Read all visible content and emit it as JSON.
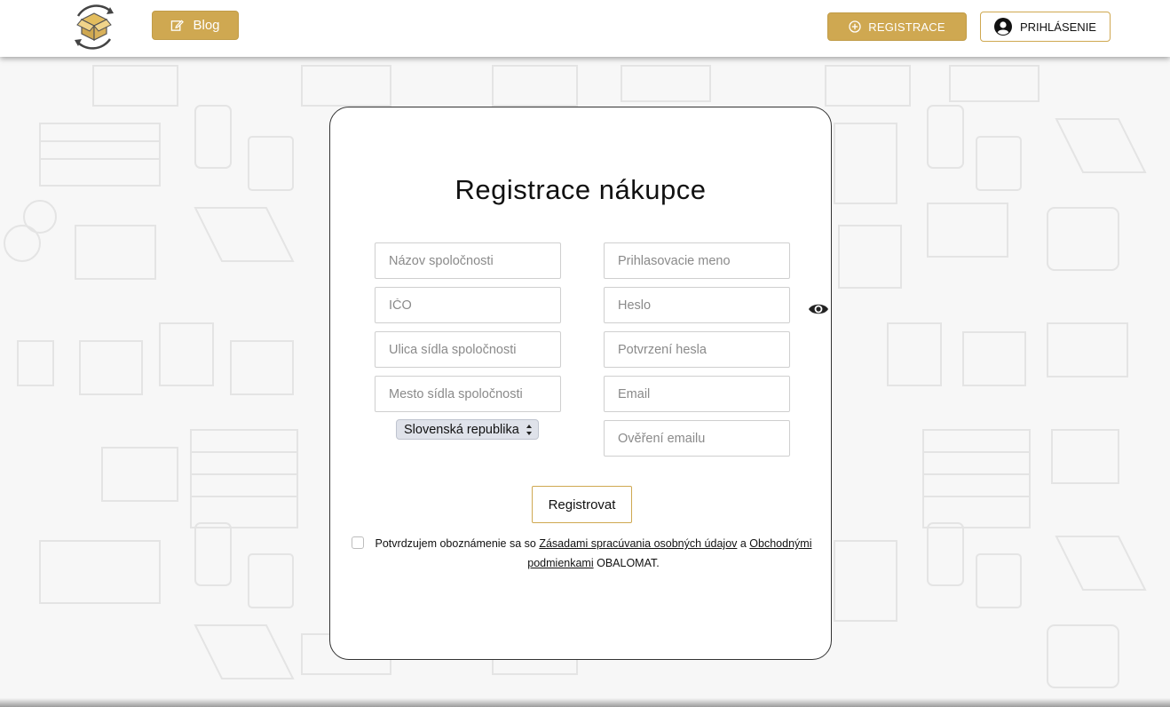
{
  "header": {
    "blog_label": "Blog",
    "register_label": "REGISTRACE",
    "login_label": "PRIHLÁSENIE"
  },
  "form": {
    "title": "Registrace nákupce",
    "left_fields": [
      {
        "placeholder": "Názov spoločnosti"
      },
      {
        "placeholder": "IČO"
      },
      {
        "placeholder": "Ulica sídla spoločnosti"
      },
      {
        "placeholder": "Mesto sídla spoločnosti"
      }
    ],
    "right_fields": [
      {
        "placeholder": "Prihlasovacie meno"
      },
      {
        "placeholder": "Heslo"
      },
      {
        "placeholder": "Potvrzení hesla"
      },
      {
        "placeholder": "Email"
      },
      {
        "placeholder": "Ověření emailu"
      }
    ],
    "country_select": "Slovenská republika",
    "submit_label": "Registrovat",
    "consent": {
      "text_before": "Potvrdzujem oboznámenie sa so ",
      "privacy_link": "Zásadami spracúvania osobných údajov",
      "text_middle": " a ",
      "terms_link": "Obchodnými podmienkami",
      "text_after": " OBALOMAT."
    }
  },
  "colors": {
    "accent": "#cfa851",
    "card_border": "#333333",
    "background": "#f7f7f7"
  },
  "icons": [
    "logo-box-icon",
    "edit-icon",
    "plus-circle-icon",
    "user-icon",
    "eye-icon"
  ]
}
